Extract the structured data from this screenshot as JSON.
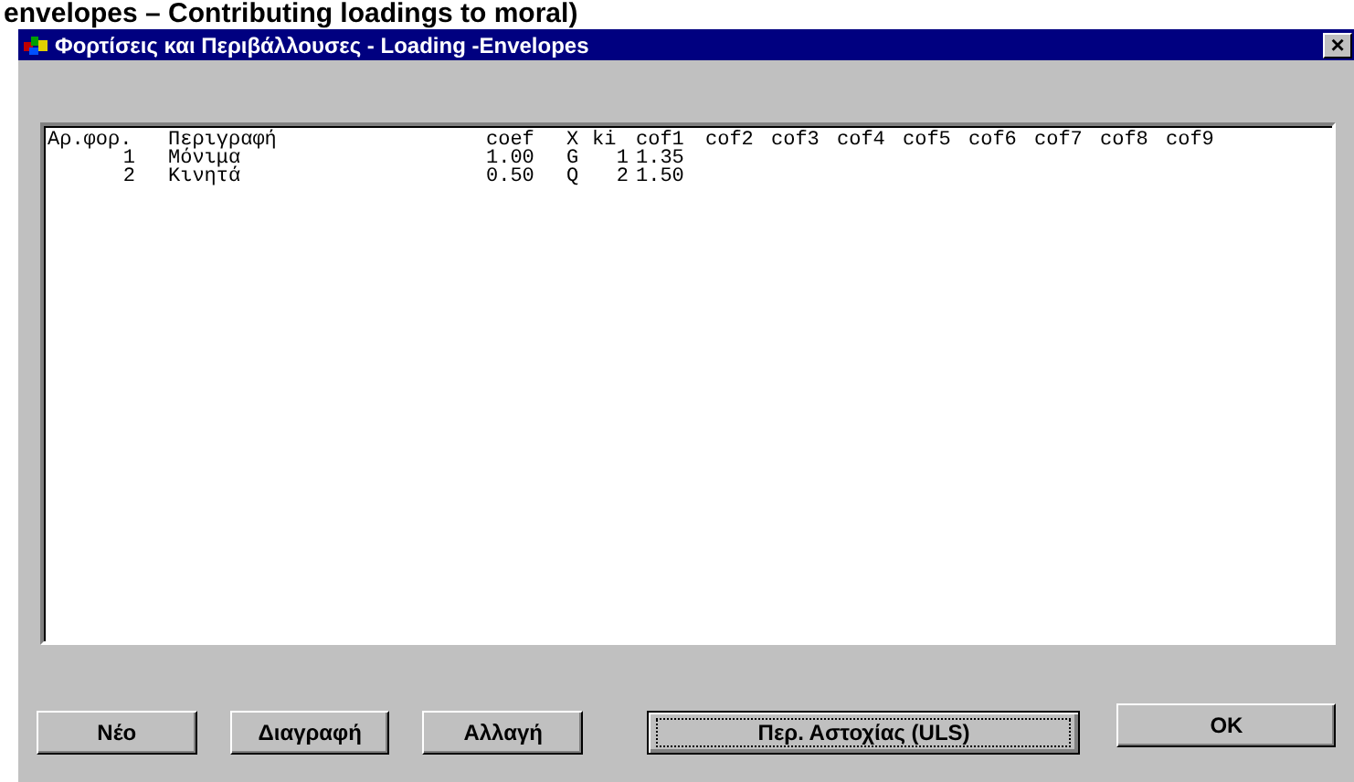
{
  "page_heading": "envelopes – Contributing loadings to moral)",
  "window": {
    "title": "Φορτίσεις και Περιβάλλουσες - Loading -Envelopes",
    "close": "×"
  },
  "table": {
    "columns": [
      "Αρ.φορ.",
      "Περιγραφή",
      "coef",
      "X",
      "ki",
      "cof1",
      "cof2",
      "cof3",
      "cof4",
      "cof5",
      "cof6",
      "cof7",
      "cof8",
      "cof9"
    ],
    "rows": [
      {
        "cells": [
          "1",
          "Μόνιμα",
          "1.00",
          "G",
          "1",
          "1.35"
        ]
      },
      {
        "cells": [
          "2",
          "Κινητά",
          "0.50",
          "Q",
          "2",
          "1.50"
        ]
      }
    ]
  },
  "buttons": [
    {
      "label": "Νέο",
      "focused": false
    },
    {
      "label": "Διαγραφή",
      "focused": false
    },
    {
      "label": "Αλλαγή",
      "focused": false
    },
    {
      "label": "Περ. Αστοχίας (ULS)",
      "focused": true
    },
    {
      "label": "OK",
      "focused": false
    }
  ]
}
